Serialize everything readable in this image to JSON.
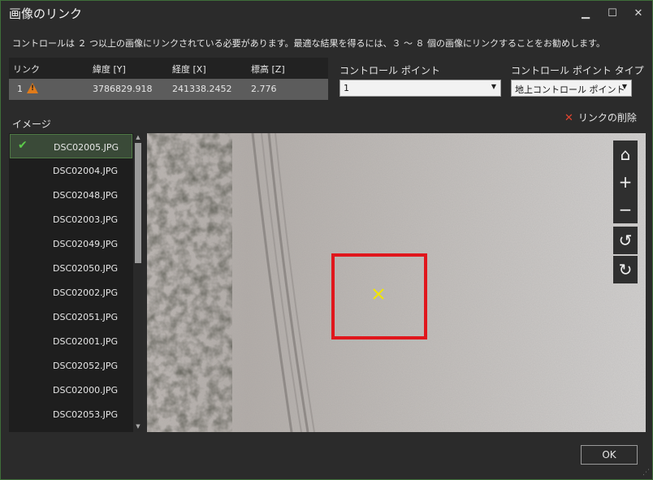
{
  "window": {
    "title": "画像のリンク",
    "minimize_glyph": "▁",
    "maximize_glyph": "☐",
    "close_glyph": "✕"
  },
  "info_text": "コントロールは ２ つ以上の画像にリンクされている必要があります。最適な結果を得るには、３ ～ ８ 個の画像にリンクすることをお勧めします。",
  "link_table": {
    "headers": [
      "リンク",
      "緯度 [Y]",
      "経度 [X]",
      "標高 [Z]"
    ],
    "row": {
      "link": "1",
      "lat": "3786829.918",
      "lon": "241338.2452",
      "elev": "2.776"
    }
  },
  "control_point": {
    "label": "コントロール ポイント",
    "value": "1"
  },
  "control_point_type": {
    "label": "コントロール ポイント タイプ",
    "value": "地上コントロール ポイント"
  },
  "delete_link_label": "リンクの削除",
  "image_label": "イメージ",
  "images": [
    "DSC02005.JPG",
    "DSC02004.JPG",
    "DSC02048.JPG",
    "DSC02003.JPG",
    "DSC02049.JPG",
    "DSC02050.JPG",
    "DSC02002.JPG",
    "DSC02051.JPG",
    "DSC02001.JPG",
    "DSC02052.JPG",
    "DSC02000.JPG",
    "DSC02053.JPG"
  ],
  "selected_image_index": 0,
  "icons": {
    "check": "✔",
    "home": "⌂",
    "zoom_in": "+",
    "zoom_out": "−",
    "rotate_left": "↺",
    "rotate_right": "↻",
    "scroll_up": "▲",
    "scroll_down": "▼",
    "dropdown": "▼",
    "delete": "✕",
    "resize_grip": "⋰"
  },
  "colors": {
    "accent_green": "#5ccb4a",
    "marker_box": "#e0161c",
    "marker_x": "#f2e600",
    "warning": "#e07b1a"
  },
  "ok_label": "OK"
}
